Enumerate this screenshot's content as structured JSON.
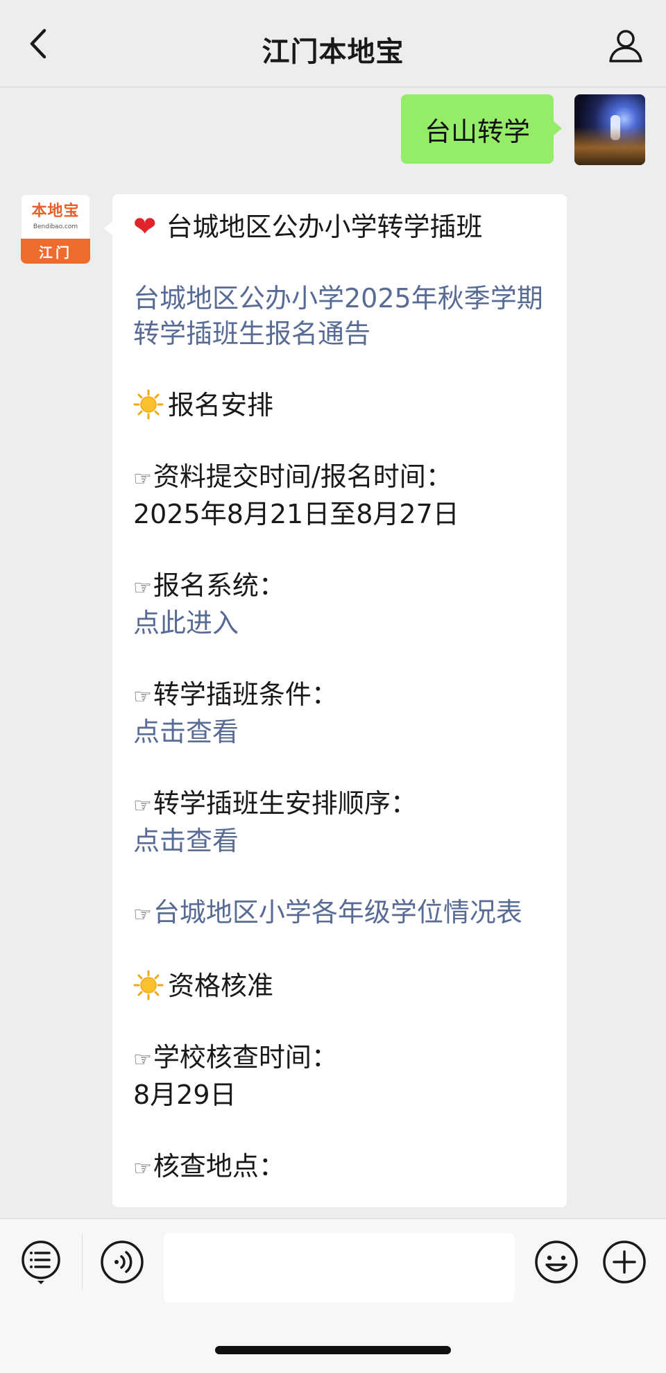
{
  "nav": {
    "title": "江门本地宝",
    "icons": {
      "back": "back-chevron-icon",
      "profile": "user-profile-icon"
    }
  },
  "sent": {
    "text": "台山转学"
  },
  "account": {
    "logo_main": "本地宝",
    "logo_sub": "Bendibao.com",
    "logo_city": "江门"
  },
  "message": {
    "heart_title": "台城地区公办小学转学插班",
    "notice_link": "台城地区公办小学2025年秋季学期转学插班生报名通告",
    "section1": "报名安排",
    "item1_label": "资料提交时间/报名时间：",
    "item1_value": "2025年8月21日至8月27日",
    "item2_label": "报名系统：",
    "item2_link": "点此进入",
    "item3_label": "转学插班条件：",
    "item3_link": "点击查看",
    "item4_label": "转学插班生安排顺序：",
    "item4_link": "点击查看",
    "item5_link": "台城地区小学各年级学位情况表",
    "section2": "资格核准",
    "item6_label": "学校核查时间：",
    "item6_value": "8月29日",
    "item7_label": "核查地点："
  },
  "inputbar": {
    "icons": [
      "menu-list-icon",
      "voice-icon",
      "emoji-icon",
      "plus-icon"
    ],
    "text_value": ""
  },
  "colors": {
    "link": "#576b95",
    "sent_bubble": "#95ec69",
    "background": "#ededed"
  }
}
